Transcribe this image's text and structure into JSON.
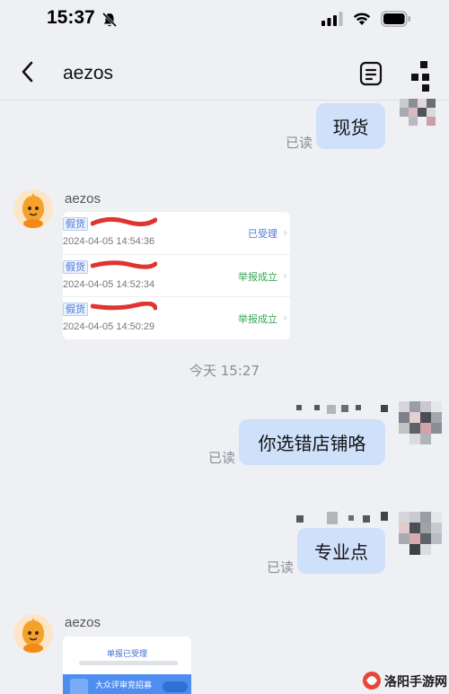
{
  "status_bar": {
    "time": "15:37"
  },
  "nav": {
    "title": "aezos"
  },
  "messages": {
    "out1": {
      "text": "现货",
      "read": "已读"
    },
    "in1": {
      "sender": "aezos",
      "reports": [
        {
          "tag": "假货",
          "time": "2024-04-05 14:54:36",
          "status": "已受理",
          "status_color": "#4a7ad9"
        },
        {
          "tag": "假货",
          "time": "2024-04-05 14:52:34",
          "status": "举报成立",
          "status_color": "#3aa655"
        },
        {
          "tag": "假货",
          "time": "2024-04-05 14:50:29",
          "status": "举报成立",
          "status_color": "#3aa655"
        }
      ]
    },
    "divider": "今天 15:27",
    "out2": {
      "text": "你选错店铺咯",
      "read": "已读"
    },
    "out3": {
      "text": "专业点",
      "read": "已读"
    },
    "in2": {
      "sender": "aezos",
      "card_title": "单报已受理",
      "banner_text": "大众评审竞招募"
    }
  },
  "watermark": {
    "text": "洛阳手游网"
  },
  "colors": {
    "bubble_out": "#cfe0fb",
    "accent": "#4a7ad9",
    "success": "#3aa655"
  }
}
